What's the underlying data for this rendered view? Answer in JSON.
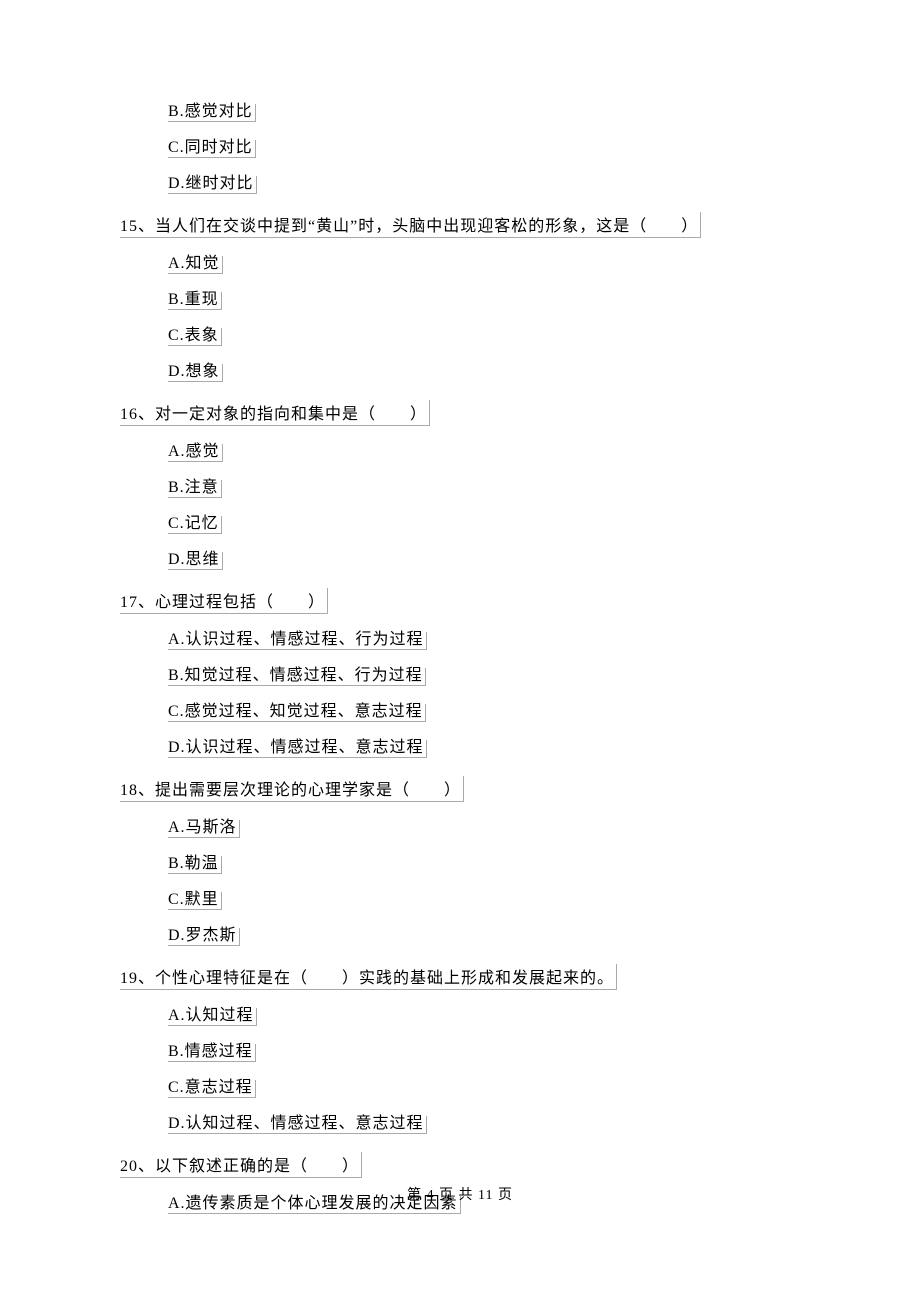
{
  "orphan_options": [
    "B.感觉对比",
    "C.同时对比",
    "D.继时对比"
  ],
  "questions": [
    {
      "num": "15、",
      "stem": "当人们在交谈中提到“黄山”时，头脑中出现迎客松的形象，这是（　　）",
      "options": [
        "A.知觉",
        "B.重现",
        "C.表象",
        "D.想象"
      ]
    },
    {
      "num": "16、",
      "stem": "对一定对象的指向和集中是（　　）",
      "options": [
        "A.感觉",
        "B.注意",
        "C.记忆",
        "D.思维"
      ]
    },
    {
      "num": "17、",
      "stem": "心理过程包括（　　）",
      "options": [
        "A.认识过程、情感过程、行为过程",
        "B.知觉过程、情感过程、行为过程",
        "C.感觉过程、知觉过程、意志过程",
        "D.认识过程、情感过程、意志过程"
      ]
    },
    {
      "num": "18、",
      "stem": "提出需要层次理论的心理学家是（　　）",
      "options": [
        "A.马斯洛",
        "B.勒温",
        "C.默里",
        "D.罗杰斯"
      ]
    },
    {
      "num": "19、",
      "stem": "个性心理特征是在（　　）实践的基础上形成和发展起来的。",
      "options": [
        "A.认知过程",
        "B.情感过程",
        "C.意志过程",
        "D.认知过程、情感过程、意志过程"
      ]
    },
    {
      "num": "20、",
      "stem": "以下叙述正确的是（　　）",
      "options": [
        "A.遗传素质是个体心理发展的决定因素"
      ]
    }
  ],
  "footer": "第 4 页 共 11 页"
}
